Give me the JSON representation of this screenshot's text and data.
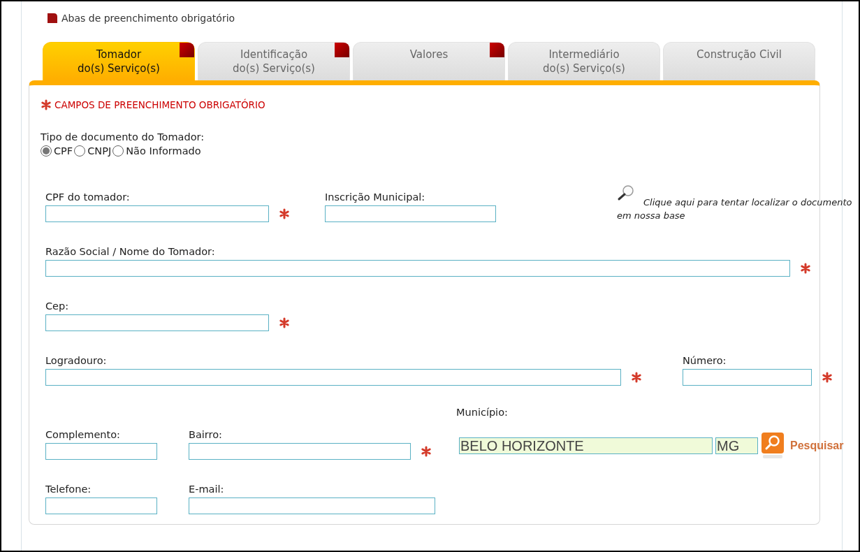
{
  "legend": "Abas de preenchimento obrigatório",
  "tabs": [
    {
      "label": "Tomador\ndo(s) Serviço(s)",
      "selected": true,
      "required": true
    },
    {
      "label": "Identificação\ndo(s) Serviço(s)",
      "selected": false,
      "required": true
    },
    {
      "label": "Valores",
      "selected": false,
      "required": true
    },
    {
      "label": "Intermediário\ndo(s) Serviço(s)",
      "selected": false,
      "required": false
    },
    {
      "label": "Construção Civil",
      "selected": false,
      "required": false
    }
  ],
  "required_note": "CAMPOS DE PREENCHIMENTO OBRIGATÓRIO",
  "doc_type": {
    "label": "Tipo de documento do Tomador:",
    "options": [
      {
        "label": "CPF",
        "selected": true
      },
      {
        "label": "CNPJ",
        "selected": false
      },
      {
        "label": "Não Informado",
        "selected": false
      }
    ]
  },
  "rows": [
    [
      {
        "kind": "text",
        "label": "CPF do tomador:",
        "required": true
      },
      {
        "kind": "text",
        "label": "Inscrição Municipal:",
        "required": false
      },
      {
        "kind": "hint",
        "text": "Clique aqui para tentar localizar o documento em nossa base"
      }
    ],
    [
      {
        "kind": "text",
        "label": "Razão Social / Nome do Tomador:",
        "required": true
      }
    ],
    [
      {
        "kind": "text",
        "label": "Cep:",
        "required": true
      }
    ],
    [
      {
        "kind": "text",
        "label": "Logradouro:",
        "required": true
      },
      {
        "kind": "text",
        "label": "Número:",
        "required": true
      }
    ],
    [
      {
        "kind": "text",
        "label": "Complemento:",
        "required": false
      },
      {
        "kind": "text",
        "label": "Bairro:",
        "required": true
      },
      {
        "kind": "city",
        "label": "Município:",
        "city": "BELO HORIZONTE",
        "state": "MG",
        "button": "Pesquisar"
      }
    ],
    [
      {
        "kind": "text",
        "label": "Telefone:",
        "required": false
      },
      {
        "kind": "text",
        "label": "E-mail:",
        "required": false
      }
    ]
  ]
}
